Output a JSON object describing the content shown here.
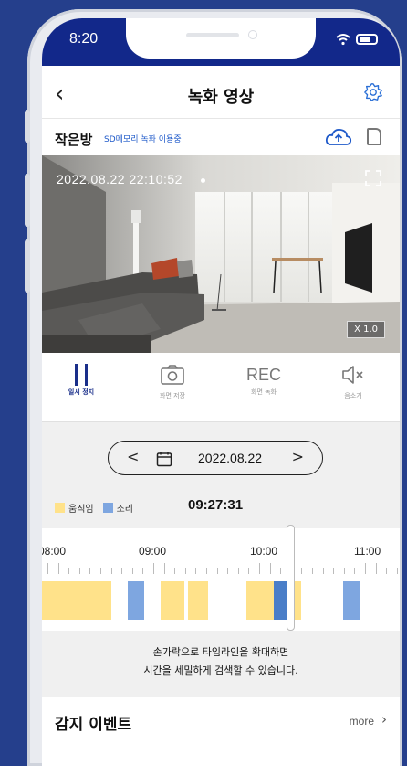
{
  "status_bar": {
    "time": "8:20"
  },
  "header": {
    "title": "녹화 영상"
  },
  "camera": {
    "name": "작은방",
    "sd_status": "SD메모리 녹화 이용중"
  },
  "video": {
    "timestamp": "2022.08.22  22:10:52",
    "zoom": "X 1.0"
  },
  "controls": [
    {
      "label": "일시 정지",
      "icon": "pause-icon",
      "active": true
    },
    {
      "label": "화면 저장",
      "icon": "camera-icon"
    },
    {
      "label": "화면 녹화",
      "icon": "rec-icon",
      "text": "REC"
    },
    {
      "label": "음소거",
      "icon": "mute-icon"
    }
  ],
  "date_picker": {
    "date": "2022.08.22",
    "prev": "<",
    "next": ">"
  },
  "legend": [
    {
      "label": "움직임",
      "color": "#ffe28a"
    },
    {
      "label": "소리",
      "color": "#7ea6e0"
    }
  ],
  "timeline": {
    "current_time": "09:27:31",
    "hours": [
      "08:00",
      "09:00",
      "10:00",
      "11:00"
    ]
  },
  "hint": {
    "line1": "손가락으로 타임라인을 확대하면",
    "line2": "시간을 세밀하게 검색할 수 있습니다."
  },
  "events": {
    "title": "감지 이벤트",
    "more": "more"
  },
  "colors": {
    "brand": "#12288a",
    "background": "#253f8c",
    "motion": "#ffe28a",
    "sound": "#7ea6e0"
  }
}
